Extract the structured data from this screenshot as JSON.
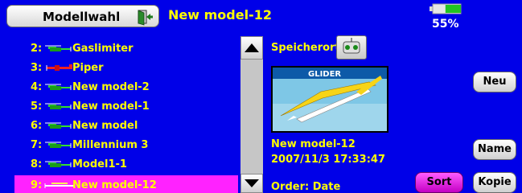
{
  "header": {
    "title": "Modellwahl",
    "current_model": "New model-12",
    "battery_percent_label": "55%",
    "battery_level": 0.55
  },
  "model_list": {
    "items": [
      {
        "number": "2:",
        "name": "Gaslimiter",
        "type": "helicopter-icon"
      },
      {
        "number": "3:",
        "name": "Piper",
        "type": "airplane-icon"
      },
      {
        "number": "4:",
        "name": "New model-2",
        "type": "helicopter-icon"
      },
      {
        "number": "5:",
        "name": "New model-1",
        "type": "helicopter-icon"
      },
      {
        "number": "6:",
        "name": "New model",
        "type": "helicopter-icon"
      },
      {
        "number": "7:",
        "name": "Millennium 3",
        "type": "helicopter-icon"
      },
      {
        "number": "8:",
        "name": "Model1-1",
        "type": "helicopter-icon"
      },
      {
        "number": "9:",
        "name": "New model-12",
        "type": "glider-icon",
        "selected": true
      }
    ]
  },
  "details": {
    "storage_label": "Speicherort",
    "preview_label": "GLIDER",
    "model_name": "New model-12",
    "model_date": "2007/11/3  17:33:47",
    "order_label": "Order: Date"
  },
  "buttons": {
    "new": "Neu",
    "name": "Name",
    "sort": "Sort",
    "copy": "Kopie"
  },
  "colors": {
    "background": "#0000e8",
    "text_yellow": "#ffff00",
    "selected_row": "#ff22ff",
    "sort_button": "#e020e0"
  }
}
